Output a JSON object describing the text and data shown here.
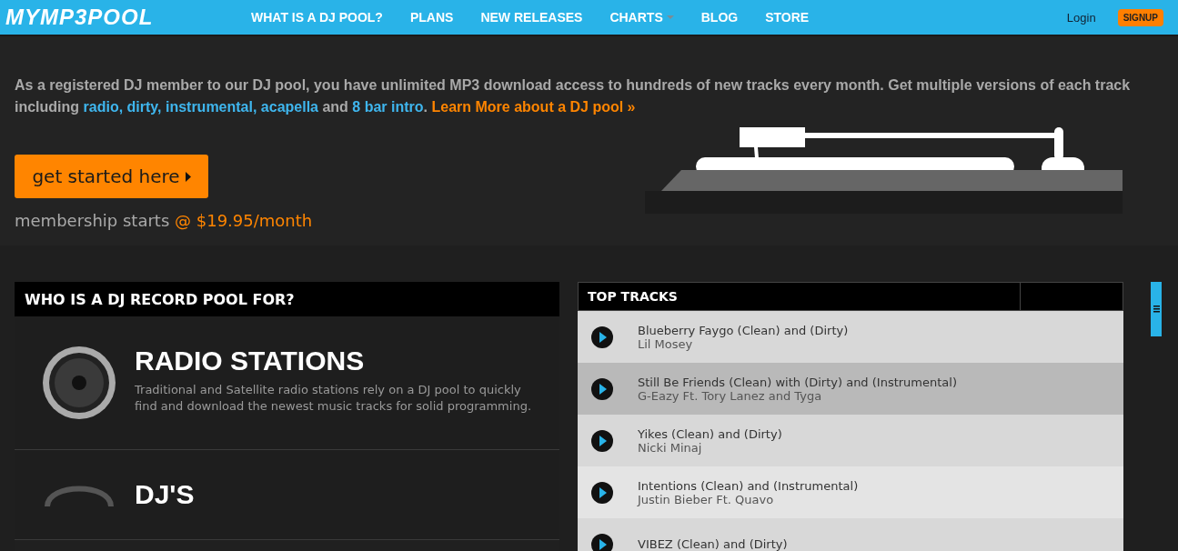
{
  "nav": {
    "logo": "MYMP3POOL",
    "links": [
      {
        "label": "WHAT IS A DJ POOL?",
        "dropdown": false
      },
      {
        "label": "PLANS",
        "dropdown": false
      },
      {
        "label": "NEW RELEASES",
        "dropdown": false
      },
      {
        "label": "CHARTS",
        "dropdown": true
      },
      {
        "label": "BLOG",
        "dropdown": false
      },
      {
        "label": "STORE",
        "dropdown": false
      }
    ],
    "login": "Login",
    "signup": "SIGNUP"
  },
  "hero": {
    "intro": [
      {
        "kind": "text",
        "text": "As a registered DJ member to our DJ pool, you have unlimited MP3 download access to hundreds of new tracks every month. Get multiple versions of each track including "
      },
      {
        "kind": "link",
        "text": "radio, dirty, instrumental, acapella"
      },
      {
        "kind": "text",
        "text": " and "
      },
      {
        "kind": "link",
        "text": "8 bar intro"
      },
      {
        "kind": "text",
        "text": ". "
      },
      {
        "kind": "cta",
        "text": "Learn More about a DJ pool »"
      }
    ],
    "button": "get started here",
    "membership": "membership starts",
    "price": "@ $19.95/month"
  },
  "who": {
    "title": "WHO IS A DJ RECORD POOL FOR?",
    "items": [
      {
        "kind": "speaker",
        "title": "RADIO STATIONS",
        "description": "Traditional and Satellite radio stations rely on a DJ pool to quickly find and download the newest music tracks for solid programming."
      },
      {
        "kind": "headphones",
        "title": "DJ'S"
      }
    ]
  },
  "top_tracks": {
    "title": "TOP TRACKS",
    "tracks": [
      {
        "title": "Blueberry Faygo (Clean) and (Dirty)",
        "artist": "Lil Mosey",
        "selected": false
      },
      {
        "title": "Still Be Friends (Clean) with (Dirty) and (Instrumental)",
        "artist": "G-Eazy Ft. Tory Lanez and Tyga",
        "selected": true
      },
      {
        "title": "Yikes (Clean) and (Dirty)",
        "artist": "Nicki Minaj",
        "selected": false
      },
      {
        "title": "Intentions (Clean) and (Instrumental)",
        "artist": "Justin Bieber Ft. Quavo",
        "selected": false
      },
      {
        "title": "VIBEZ (Clean) and (Dirty)",
        "selected": false
      }
    ]
  }
}
